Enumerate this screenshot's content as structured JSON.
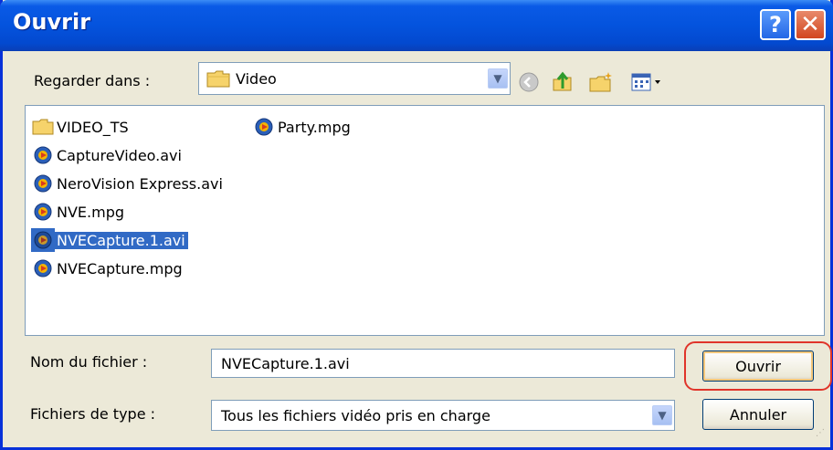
{
  "window": {
    "title": "Ouvrir",
    "help_label": "?",
    "close_label": "✕"
  },
  "look_in": {
    "label": "Regarder dans :",
    "value": "Video"
  },
  "toolbar": {
    "icons": [
      "back-icon",
      "up-folder-icon",
      "new-folder-icon",
      "view-menu-icon"
    ]
  },
  "files": {
    "items": [
      {
        "name": "VIDEO_TS",
        "type": "folder"
      },
      {
        "name": "CaptureVideo.avi",
        "type": "video"
      },
      {
        "name": "NeroVision Express.avi",
        "type": "video"
      },
      {
        "name": "NVE.mpg",
        "type": "video"
      },
      {
        "name": "NVECapture.1.avi",
        "type": "video",
        "selected": true
      },
      {
        "name": "NVECapture.mpg",
        "type": "video"
      },
      {
        "name": "Party.mpg",
        "type": "video"
      }
    ]
  },
  "filename": {
    "label": "Nom du fichier :",
    "value": "NVECapture.1.avi"
  },
  "filetype": {
    "label": "Fichiers de type :",
    "value": "Tous les fichiers vidéo pris en charge"
  },
  "buttons": {
    "open": "Ouvrir",
    "cancel": "Annuler"
  },
  "colors": {
    "titlebar": "#0453dd",
    "selection": "#316ac5",
    "highlight_ring": "#e0342a"
  }
}
